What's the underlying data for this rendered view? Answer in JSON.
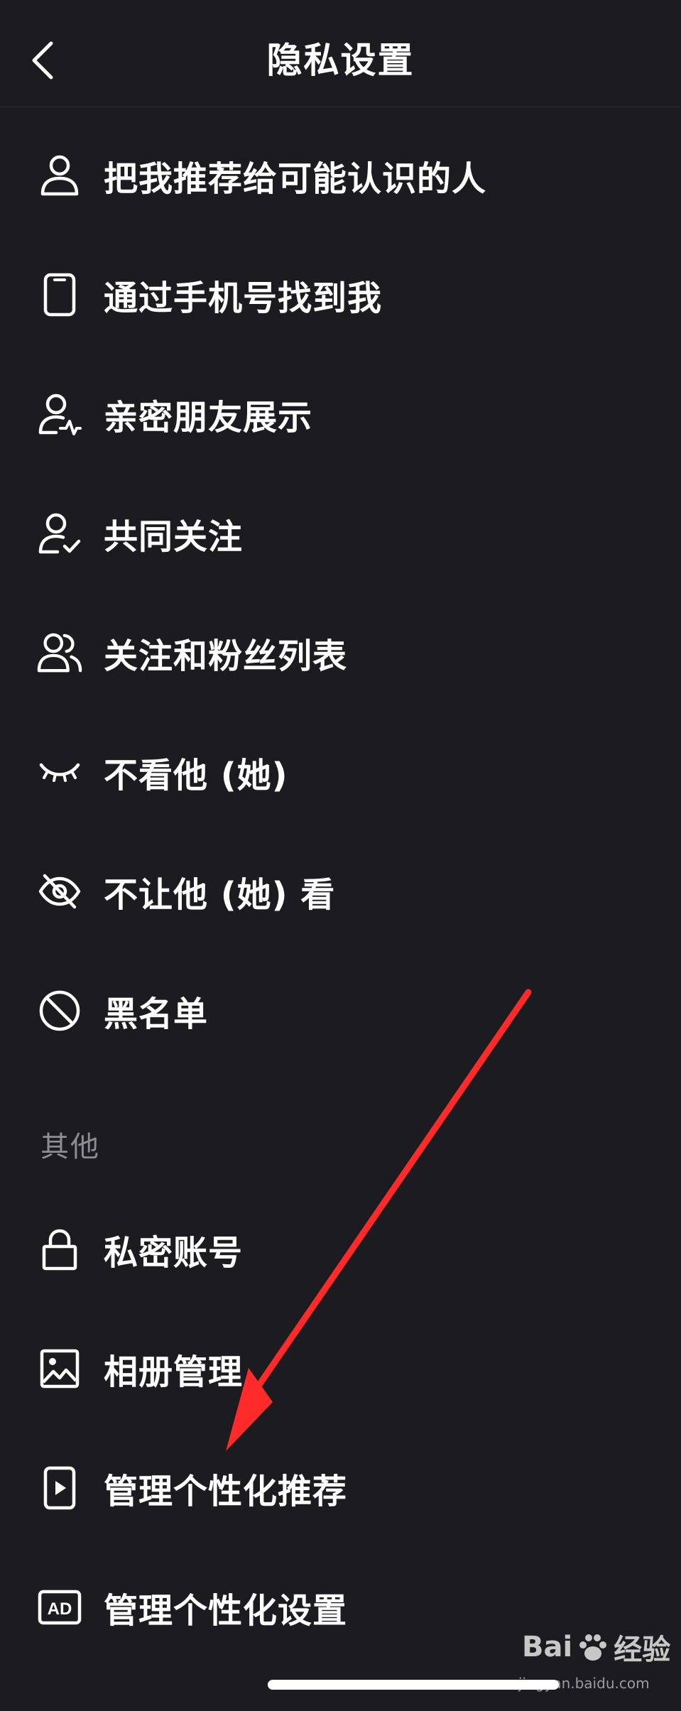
{
  "header": {
    "title": "隐私设置",
    "back_icon": "chevron-left-icon"
  },
  "items": [
    {
      "label": "把我推荐给可能认识的人",
      "icon": "person-icon"
    },
    {
      "label": "通过手机号找到我",
      "icon": "phone-icon"
    },
    {
      "label": "亲密朋友展示",
      "icon": "person-heartbeat-icon"
    },
    {
      "label": "共同关注",
      "icon": "person-check-icon"
    },
    {
      "label": "关注和粉丝列表",
      "icon": "people-icon"
    },
    {
      "label": "不看他 (她)",
      "icon": "closed-eye-icon"
    },
    {
      "label": "不让他 (她) 看",
      "icon": "eye-off-icon"
    },
    {
      "label": "黑名单",
      "icon": "block-icon"
    }
  ],
  "section_other": {
    "title": "其他",
    "items": [
      {
        "label": "私密账号",
        "icon": "lock-icon"
      },
      {
        "label": "相册管理",
        "icon": "image-icon"
      },
      {
        "label": "管理个性化推荐",
        "icon": "phone-play-icon"
      },
      {
        "label": "管理个性化设置",
        "icon": "ad-icon",
        "icon_text": "AD"
      }
    ]
  },
  "watermark": {
    "brand_left": "Bai",
    "brand_right": "经验",
    "url": "jingyan.baidu.com"
  },
  "colors": {
    "background": "#1c1b20",
    "text": "#ffffff",
    "section": "#8e8d93",
    "annotation_arrow": "#ff2a2a"
  }
}
